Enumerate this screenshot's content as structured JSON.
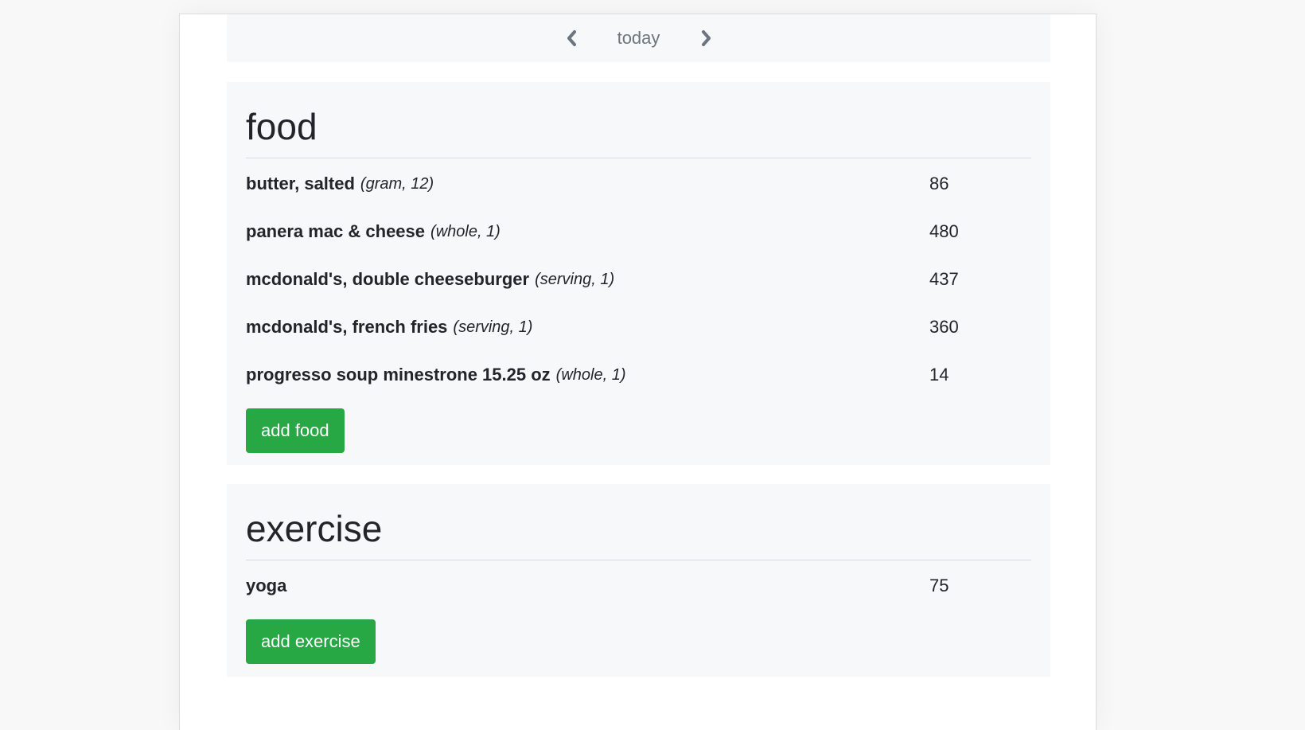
{
  "date_nav": {
    "label": "today",
    "prev_icon": "chevron-left-icon",
    "next_icon": "chevron-right-icon"
  },
  "food": {
    "heading": "food",
    "items": [
      {
        "name": "butter, salted",
        "detail": "(gram, 12)",
        "calories": "86"
      },
      {
        "name": "panera mac & cheese",
        "detail": "(whole, 1)",
        "calories": "480"
      },
      {
        "name": "mcdonald's, double cheeseburger",
        "detail": "(serving, 1)",
        "calories": "437"
      },
      {
        "name": "mcdonald's, french fries",
        "detail": "(serving, 1)",
        "calories": "360"
      },
      {
        "name": "progresso soup minestrone 15.25 oz",
        "detail": "(whole, 1)",
        "calories": "14"
      }
    ],
    "add_button": "add food"
  },
  "exercise": {
    "heading": "exercise",
    "items": [
      {
        "name": "yoga",
        "calories": "75"
      }
    ],
    "add_button": "add exercise"
  },
  "colors": {
    "accent": "#28a745",
    "card_bg": "#f7f8fa",
    "muted": "#6c757d"
  }
}
